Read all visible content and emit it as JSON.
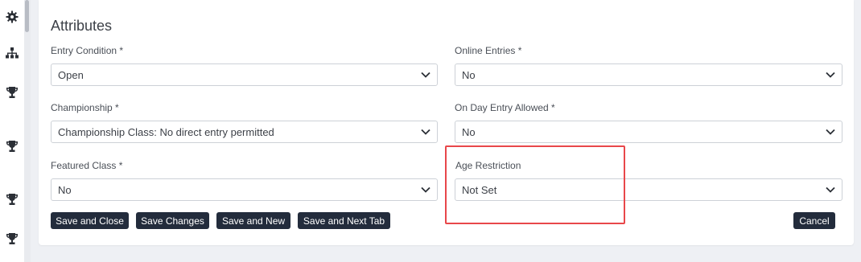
{
  "sidebar": {
    "icons": [
      "gear-icon",
      "sitemap-icon",
      "trophy-icon",
      "trophy-icon",
      "trophy-icon",
      "trophy-icon"
    ]
  },
  "form": {
    "title": "Attributes",
    "entry_condition": {
      "label": "Entry Condition *",
      "value": "Open"
    },
    "online_entries": {
      "label": "Online Entries *",
      "value": "No"
    },
    "championship": {
      "label": "Championship *",
      "value": "Championship Class: No direct entry permitted"
    },
    "on_day_entry": {
      "label": "On Day Entry Allowed *",
      "value": "No"
    },
    "featured_class": {
      "label": "Featured Class *",
      "value": "No"
    },
    "age_restriction": {
      "label": "Age Restriction",
      "value": "Not Set"
    }
  },
  "buttons": {
    "save_close": "Save and Close",
    "save_changes": "Save Changes",
    "save_new": "Save and New",
    "save_next_tab": "Save and Next Tab",
    "cancel": "Cancel"
  },
  "colors": {
    "button_bg": "#232c3c",
    "highlight": "#e8474a"
  }
}
